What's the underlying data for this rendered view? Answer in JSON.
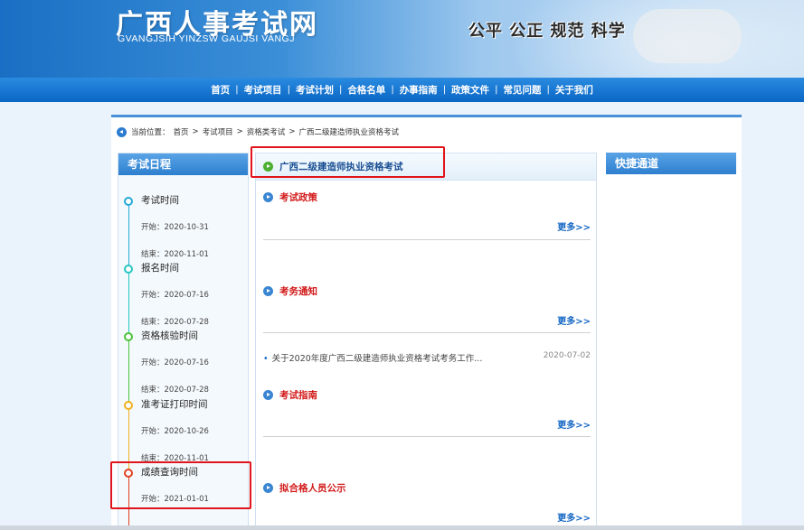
{
  "header": {
    "title": "广西人事考试网",
    "subtitle": "GVANGJSIH YINZSW GAUJSI VANGJ",
    "slogan": "公平 公正 规范 科学"
  },
  "nav": {
    "items": [
      "首页",
      "考试项目",
      "考试计划",
      "合格名单",
      "办事指南",
      "政策文件",
      "常见问题",
      "关于我们"
    ]
  },
  "breadcrumb": {
    "prefix": "当前位置：",
    "items": [
      "首页",
      "考试项目",
      "资格类考试",
      "广西二级建造师执业资格考试"
    ],
    "separator": ">"
  },
  "schedule": {
    "heading": "考试日程",
    "items": [
      {
        "title": "考试时间",
        "start": "开始：2020-10-31",
        "end": "结束：2020-11-01",
        "color": "#25a9d6"
      },
      {
        "title": "报名时间",
        "start": "开始：2020-07-16",
        "end": "结束：2020-07-28",
        "color": "#26c6c0"
      },
      {
        "title": "资格核验时间",
        "start": "开始：2020-07-16",
        "end": "结束：2020-07-28",
        "color": "#4cc23b"
      },
      {
        "title": "准考证打印时间",
        "start": "开始：2020-10-26",
        "end": "结束：2020-11-01",
        "color": "#f0b020"
      },
      {
        "title": "成绩查询时间",
        "start": "开始：2021-01-01",
        "end": "",
        "color": "#e04020"
      }
    ]
  },
  "main": {
    "heading": "广西二级建造师执业资格考试",
    "more_label": "更多>>",
    "sections": [
      {
        "title": "考试政策",
        "items": []
      },
      {
        "title": "考务通知",
        "items": [
          {
            "text": "关于2020年度广西二级建造师执业资格考试考务工作...",
            "date": "2020-07-02"
          }
        ]
      },
      {
        "title": "考试指南",
        "items": []
      },
      {
        "title": "拟合格人员公示",
        "items": []
      }
    ]
  },
  "quick": {
    "heading": "快捷通道"
  },
  "colors": {
    "nav_bg": "#0a66c4",
    "section_title": "#d21a1a",
    "highlight": "#e0141a",
    "more_link": "#1466c4"
  }
}
